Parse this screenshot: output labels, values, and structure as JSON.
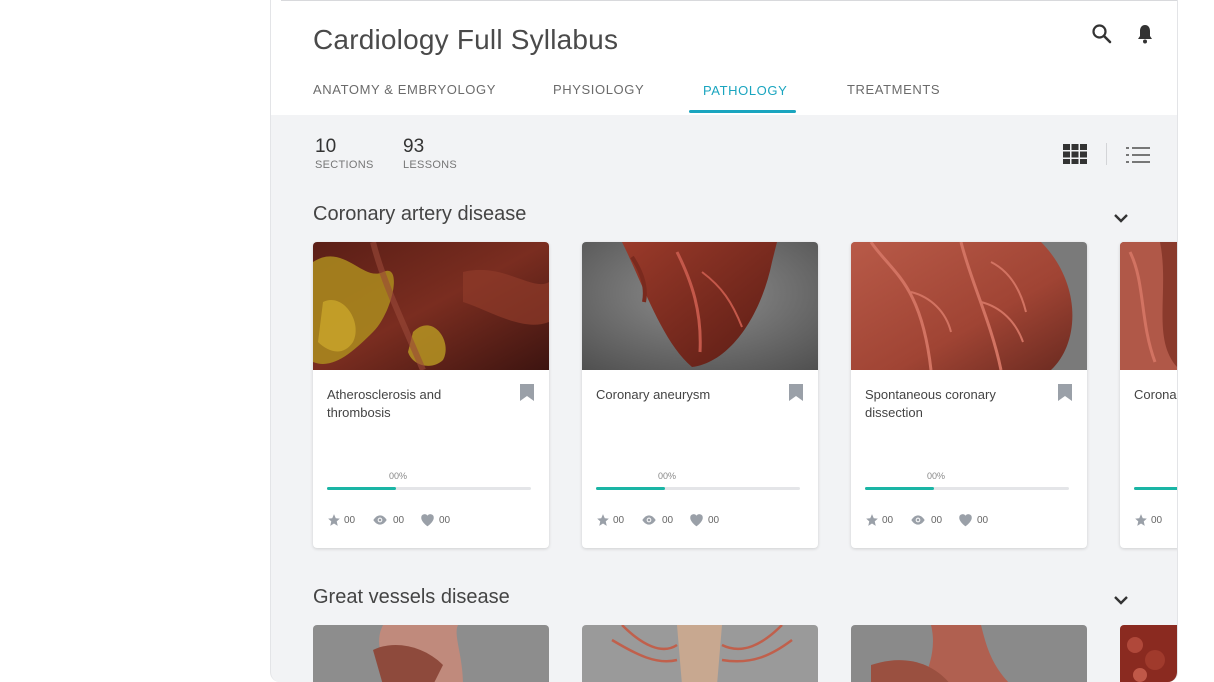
{
  "header": {
    "title": "Cardiology Full Syllabus",
    "tabs": [
      {
        "label": "ANATOMY & EMBRYOLOGY",
        "active": false
      },
      {
        "label": "PHYSIOLOGY",
        "active": false
      },
      {
        "label": "PATHOLOGY",
        "active": true
      },
      {
        "label": "TREATMENTS",
        "active": false
      }
    ],
    "icons": [
      "search-icon",
      "bell-icon"
    ]
  },
  "stats": [
    {
      "value": "10",
      "label": "SECTIONS"
    },
    {
      "value": "93",
      "label": "LESSONS"
    }
  ],
  "view_toggle": {
    "grid_icon": "grid-view-icon",
    "list_icon": "list-view-icon",
    "selected": "grid"
  },
  "sections": [
    {
      "title": "Coronary artery disease",
      "cards": [
        {
          "title": "Atherosclerosis and thrombosis",
          "progress_label": "00%",
          "progress": 0.34,
          "rating": "00",
          "views": "00",
          "likes": "00"
        },
        {
          "title": "Coronary aneurysm",
          "progress_label": "00%",
          "progress": 0.34,
          "rating": "00",
          "views": "00",
          "likes": "00"
        },
        {
          "title": "Spontaneous coronary dissection",
          "progress_label": "00%",
          "progress": 0.34,
          "rating": "00",
          "views": "00",
          "likes": "00"
        },
        {
          "title": "Corona",
          "progress_label": "",
          "progress": 0.34,
          "rating": "00",
          "views": "",
          "likes": ""
        }
      ]
    },
    {
      "title": "Great vessels disease",
      "cards": []
    }
  ],
  "colors": {
    "accent": "#1aa5bf",
    "progress": "#1ab5a5",
    "icon": "#9aa0a8"
  }
}
